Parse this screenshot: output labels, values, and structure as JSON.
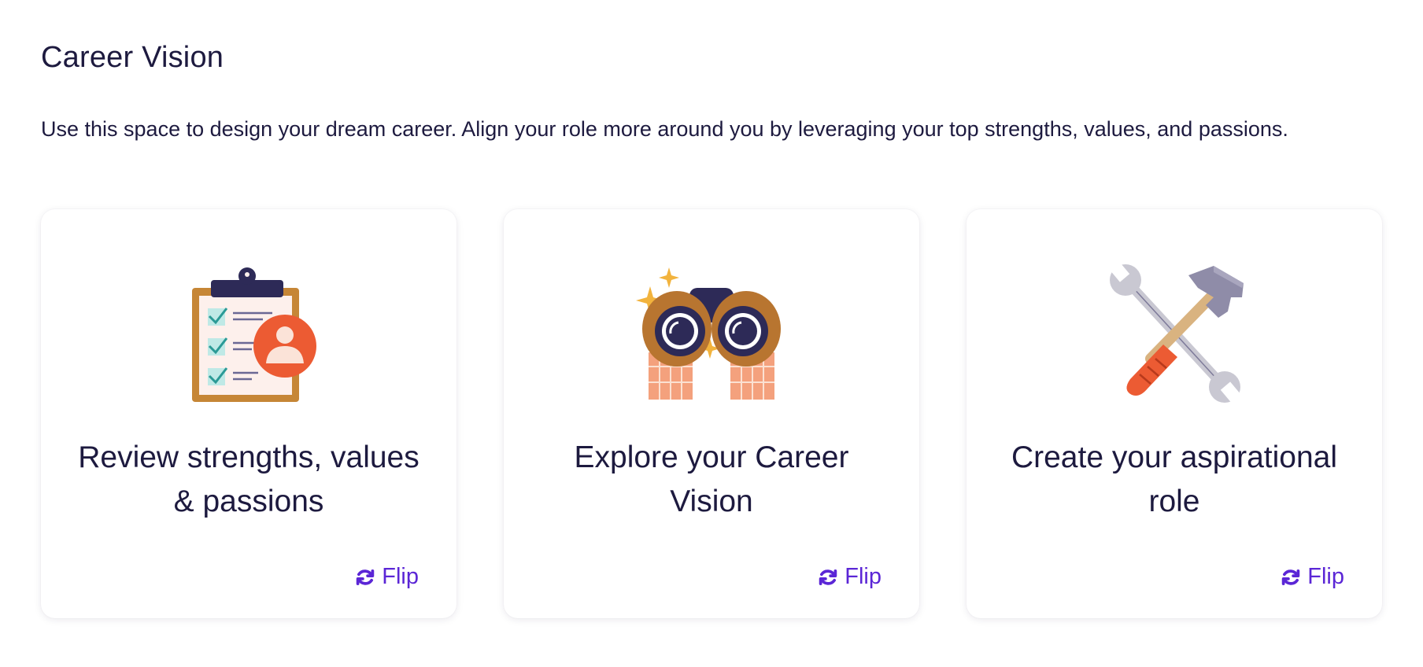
{
  "page": {
    "title": "Career Vision",
    "description": "Use this space to design your dream career. Align your role more around you by leveraging your top strengths, values, and passions."
  },
  "cards": [
    {
      "title": "Review strengths, values & passions",
      "icon": "clipboard-checklist-icon",
      "flip_label": "Flip"
    },
    {
      "title": "Explore your Career Vision",
      "icon": "binoculars-icon",
      "flip_label": "Flip"
    },
    {
      "title": "Create your aspirational role",
      "icon": "wrench-hammer-icon",
      "flip_label": "Flip"
    }
  ],
  "colors": {
    "accent": "#5b26d6",
    "text": "#1d1a3f",
    "orange": "#ec5b33",
    "brown": "#b87530"
  }
}
